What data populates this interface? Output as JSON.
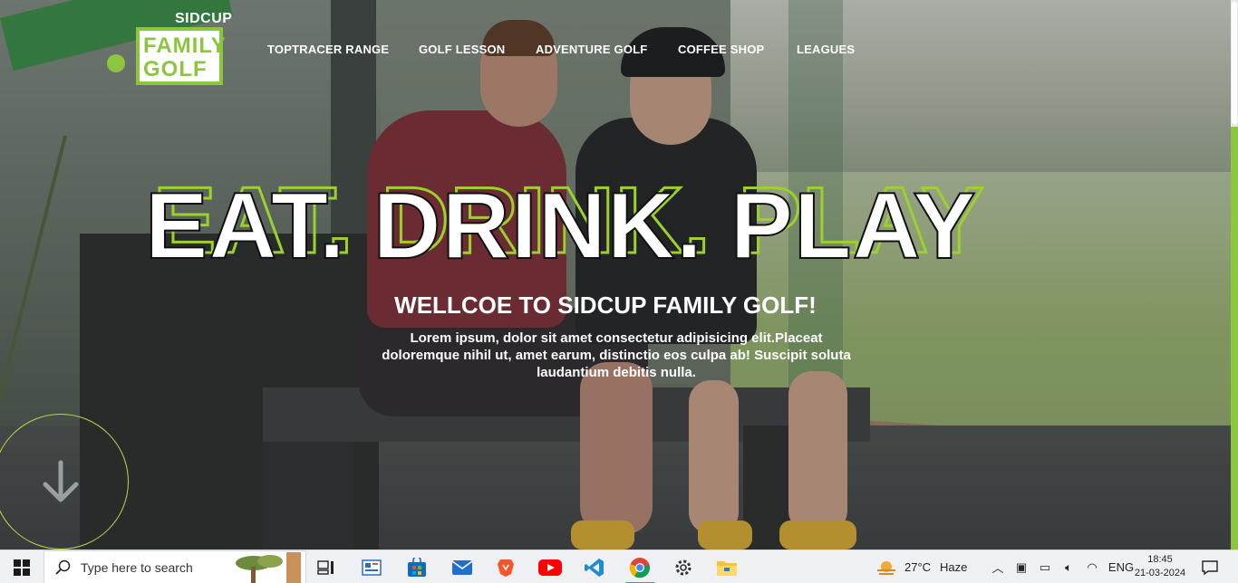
{
  "logo": {
    "top": "SIDCUP",
    "line1": "FAMILY",
    "line2": "GOLF"
  },
  "nav": {
    "items": [
      {
        "label": "TOPTRACER RANGE"
      },
      {
        "label": "GOLF LESSON"
      },
      {
        "label": "ADVENTURE GOLF"
      },
      {
        "label": "COFFEE SHOP"
      },
      {
        "label": "LEAGUES"
      }
    ]
  },
  "hero": {
    "headline": "EAT. DRINK. PLAY",
    "subtitle": "WELLCOE TO SIDCUP FAMILY GOLF!",
    "intro": "Lorem ipsum, dolor sit amet consectetur adipisicing elit.Placeat doloremque nihil ut, amet earum, distinctio eos culpa ab! Suscipit soluta laudantium debitis nulla."
  },
  "colors": {
    "accent": "#8cc63f",
    "text": "#ffffff"
  },
  "taskbar": {
    "search_placeholder": "Type here to search",
    "apps": [
      "task-view-icon",
      "news-icon",
      "store-icon",
      "mail-icon",
      "brave-icon",
      "youtube-icon",
      "vscode-icon",
      "chrome-icon",
      "settings-icon",
      "file-explorer-icon"
    ],
    "weather": {
      "temp": "27°C",
      "condition": "Haze"
    },
    "language": "ENG",
    "time": "18:45",
    "date": "21-03-2024"
  }
}
